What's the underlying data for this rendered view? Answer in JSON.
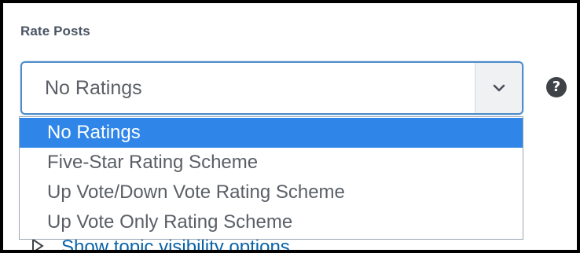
{
  "field": {
    "label": "Rate Posts",
    "selected_value": "No Ratings",
    "help_glyph": "?"
  },
  "dropdown": {
    "options": [
      {
        "label": "No Ratings",
        "selected": true
      },
      {
        "label": "Five-Star Rating Scheme",
        "selected": false
      },
      {
        "label": "Up Vote/Down Vote Rating Scheme",
        "selected": false
      },
      {
        "label": "Up Vote Only Rating Scheme",
        "selected": false
      }
    ]
  },
  "below": {
    "link_text": "Show topic visibility options"
  },
  "icons": {
    "caret": "chevron-down-icon",
    "help": "help-icon",
    "expand": "expand-triangle-icon"
  },
  "colors": {
    "focus_border": "#4f8cc9",
    "selected_bg": "#2f86e8",
    "link": "#0a63a8"
  }
}
